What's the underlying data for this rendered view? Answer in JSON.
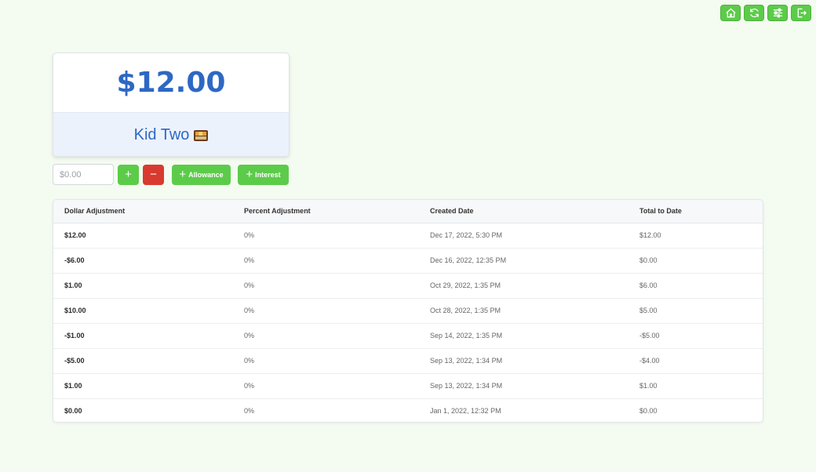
{
  "toolbar": {
    "icons": [
      "home-icon",
      "refresh-icon",
      "settings-sliders-icon",
      "logout-icon"
    ],
    "accent": "#5ccb4a"
  },
  "balance": {
    "amount": "$12.00",
    "kid_name": "Kid Two",
    "kid_emoji": "bento-box-icon",
    "color": "#2d68c4"
  },
  "controls": {
    "amount_placeholder": "$0.00",
    "add_glyph": "+",
    "subtract_glyph": "−",
    "allowance_label": "Allowance",
    "interest_label": "Interest",
    "danger": "#d93a2f"
  },
  "table": {
    "headers": [
      "Dollar Adjustment",
      "Percent Adjustment",
      "Created Date",
      "Total to Date"
    ],
    "rows": [
      [
        "$12.00",
        "0%",
        "Dec 17, 2022, 5:30 PM",
        "$12.00"
      ],
      [
        "-$6.00",
        "0%",
        "Dec 16, 2022, 12:35 PM",
        "$0.00"
      ],
      [
        "$1.00",
        "0%",
        "Oct 29, 2022, 1:35 PM",
        "$6.00"
      ],
      [
        "$10.00",
        "0%",
        "Oct 28, 2022, 1:35 PM",
        "$5.00"
      ],
      [
        "-$1.00",
        "0%",
        "Sep 14, 2022, 1:35 PM",
        "-$5.00"
      ],
      [
        "-$5.00",
        "0%",
        "Sep 13, 2022, 1:34 PM",
        "-$4.00"
      ],
      [
        "$1.00",
        "0%",
        "Sep 13, 2022, 1:34 PM",
        "$1.00"
      ],
      [
        "$0.00",
        "0%",
        "Jan 1, 2022, 12:32 PM",
        "$0.00"
      ]
    ]
  }
}
